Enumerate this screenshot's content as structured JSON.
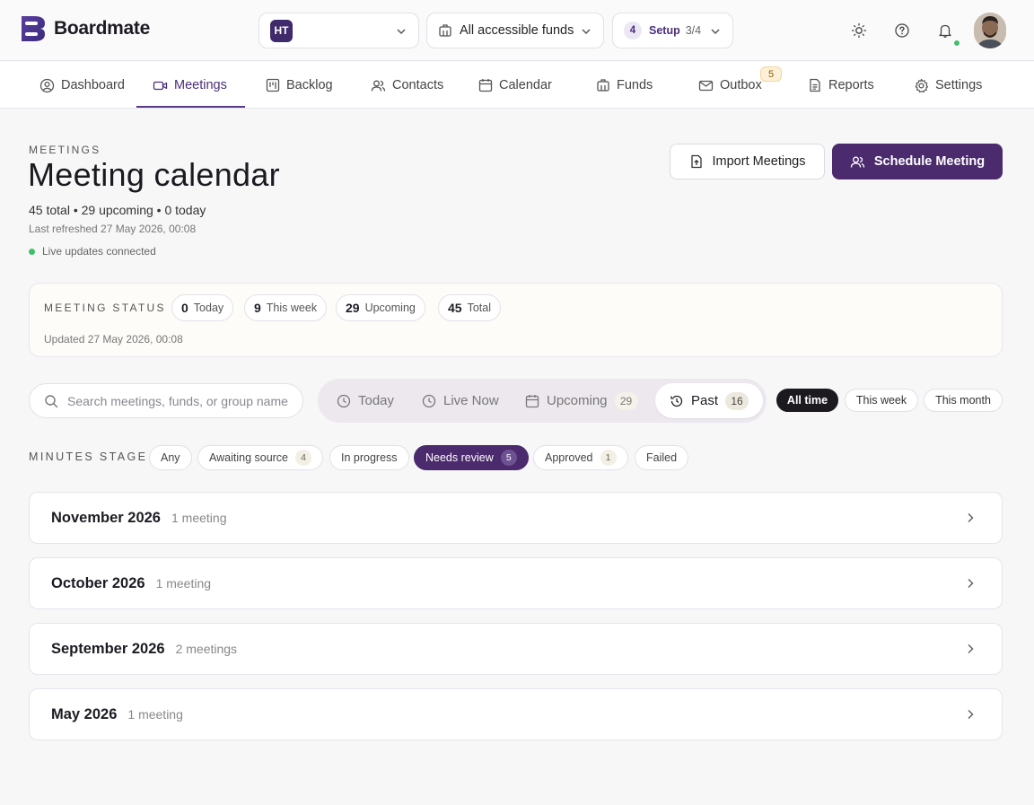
{
  "app": {
    "name": "Boardmate"
  },
  "topbar": {
    "org_badge": "HT",
    "funds_label": "All accessible funds",
    "setup": {
      "step": "4",
      "label": "Setup",
      "progress": "3/4"
    }
  },
  "nav": {
    "items": [
      {
        "label": "Dashboard"
      },
      {
        "label": "Meetings"
      },
      {
        "label": "Backlog"
      },
      {
        "label": "Contacts"
      },
      {
        "label": "Calendar"
      },
      {
        "label": "Funds"
      },
      {
        "label": "Outbox"
      },
      {
        "label": "Reports"
      },
      {
        "label": "Settings"
      }
    ],
    "outbox_badge": "5"
  },
  "header": {
    "eyebrow": "MEETINGS",
    "title": "Meeting calendar",
    "summary": "45 total • 29 upcoming • 0 today",
    "refreshed": "Last refreshed 27 May 2026, 00:08",
    "live": "Live updates connected",
    "import_label": "Import Meetings",
    "schedule_label": "Schedule Meeting"
  },
  "status": {
    "title": "MEETING STATUS",
    "pills": [
      {
        "num": "0",
        "label": "Today"
      },
      {
        "num": "9",
        "label": "This week"
      },
      {
        "num": "29",
        "label": "Upcoming"
      },
      {
        "num": "45",
        "label": "Total"
      }
    ],
    "updated": "Updated 27 May 2026, 00:08"
  },
  "search": {
    "placeholder": "Search meetings, funds, or group name"
  },
  "segments": [
    {
      "label": "Today"
    },
    {
      "label": "Live Now"
    },
    {
      "label": "Upcoming",
      "count": "29"
    },
    {
      "label": "Past",
      "count": "16"
    }
  ],
  "ranges": [
    {
      "label": "All time"
    },
    {
      "label": "This week"
    },
    {
      "label": "This month"
    }
  ],
  "minutes_stage": {
    "title": "MINUTES STAGE",
    "chips": [
      {
        "label": "Any"
      },
      {
        "label": "Awaiting source",
        "count": "4"
      },
      {
        "label": "In progress"
      },
      {
        "label": "Needs review",
        "count": "5"
      },
      {
        "label": "Approved",
        "count": "1"
      },
      {
        "label": "Failed"
      }
    ]
  },
  "months": [
    {
      "name": "November 2026",
      "count": "1 meeting"
    },
    {
      "name": "October 2026",
      "count": "1 meeting"
    },
    {
      "name": "September 2026",
      "count": "2 meetings"
    },
    {
      "name": "May 2026",
      "count": "1 meeting"
    }
  ],
  "colors": {
    "brand": "#4b2a6d",
    "accent": "#5a3a8a",
    "live": "#3ec06a"
  }
}
